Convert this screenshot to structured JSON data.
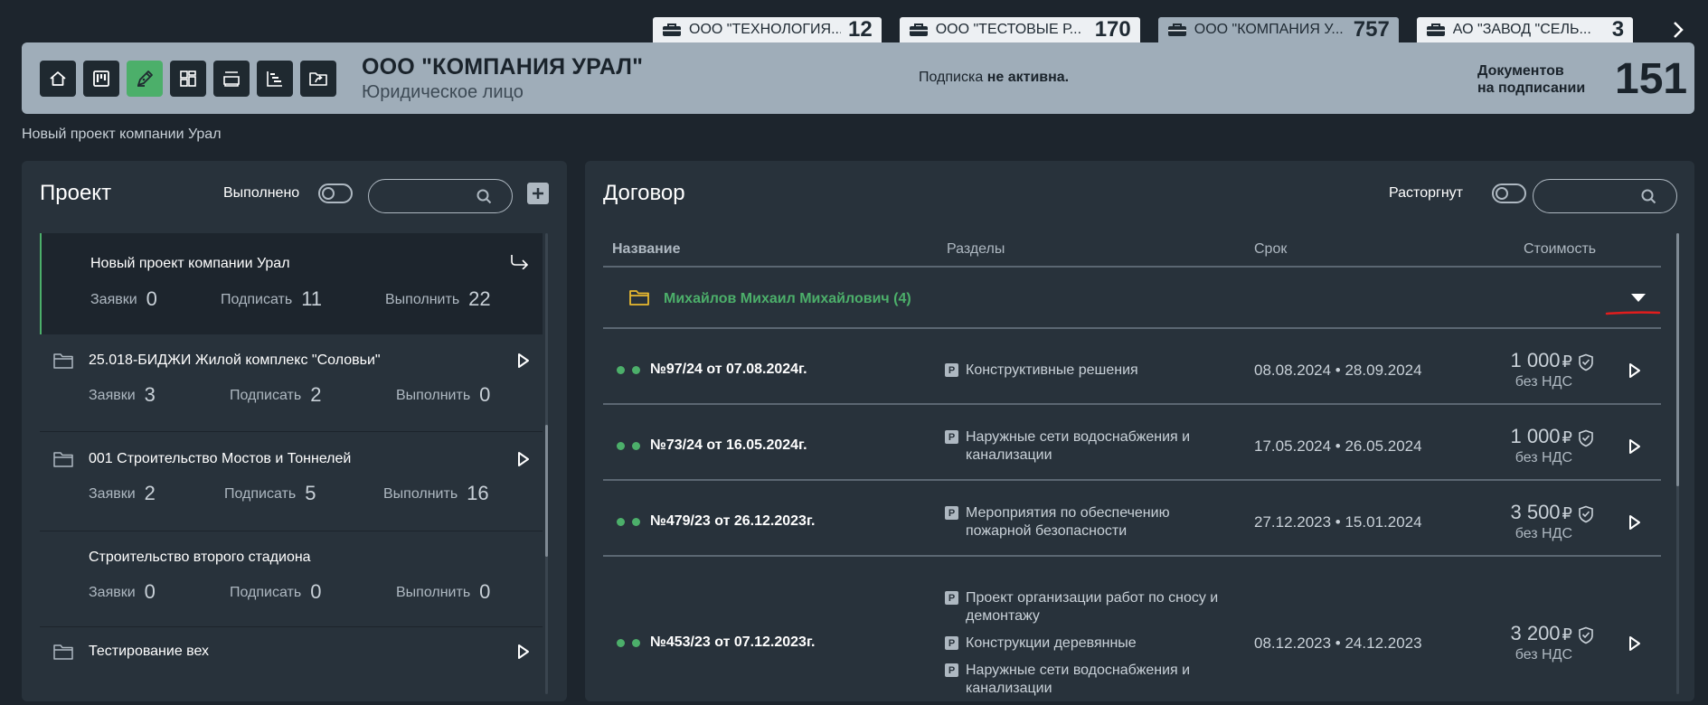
{
  "company_tabs": [
    {
      "name": "ООО \"ТЕХНОЛОГИЯ...",
      "count": "12",
      "active": false
    },
    {
      "name": "ООО \"ТЕСТОВЫЕ Р...",
      "count": "170",
      "active": false
    },
    {
      "name": "ООО \"КОМПАНИЯ У...",
      "count": "757",
      "active": true
    },
    {
      "name": "АО \"ЗАВОД \"СЕЛЬ...",
      "count": "3",
      "active": false
    }
  ],
  "toolbar": {
    "buttons": [
      "home-icon",
      "kanban-icon",
      "pen-icon",
      "dashboard-icon",
      "layers-icon",
      "gantt-icon",
      "folder-share-icon"
    ],
    "active_index": 2
  },
  "header": {
    "company_name": "ООО \"КОМПАНИЯ УРАЛ\"",
    "company_type": "Юридическое лицо",
    "subscription_prefix": "Подписка",
    "subscription_status": "не активна.",
    "docs_label_line1": "Документов",
    "docs_label_line2": "на подписании",
    "docs_count": "151"
  },
  "breadcrumb": "Новый проект компании Урал",
  "projects_panel": {
    "title": "Проект",
    "toggle_label": "Выполнено",
    "search_placeholder": "",
    "items": [
      {
        "name": "Новый проект компании Урал",
        "has_folder": false,
        "selected": true,
        "action": "redirect",
        "stats": [
          {
            "label": "Заявки",
            "value": "0"
          },
          {
            "label": "Подписать",
            "value": "11"
          },
          {
            "label": "Выполнить",
            "value": "22"
          }
        ]
      },
      {
        "name": "25.018-БИДЖИ Жилой комплекс \"Соловьи\"",
        "has_folder": true,
        "selected": false,
        "action": "play",
        "stats": [
          {
            "label": "Заявки",
            "value": "3"
          },
          {
            "label": "Подписать",
            "value": "2"
          },
          {
            "label": "Выполнить",
            "value": "0"
          }
        ]
      },
      {
        "name": "001 Строительство Мостов и Тоннелей",
        "has_folder": true,
        "selected": false,
        "action": "play",
        "stats": [
          {
            "label": "Заявки",
            "value": "2"
          },
          {
            "label": "Подписать",
            "value": "5"
          },
          {
            "label": "Выполнить",
            "value": "16"
          }
        ]
      },
      {
        "name": "Строительство второго стадиона",
        "has_folder": false,
        "selected": false,
        "action": "none",
        "stats": [
          {
            "label": "Заявки",
            "value": "0"
          },
          {
            "label": "Подписать",
            "value": "0"
          },
          {
            "label": "Выполнить",
            "value": "0"
          }
        ]
      },
      {
        "name": "Тестирование вех",
        "has_folder": true,
        "selected": false,
        "action": "play",
        "stats": []
      }
    ]
  },
  "contracts_panel": {
    "title": "Договор",
    "toggle_label": "Расторгнут",
    "search_placeholder": "",
    "columns": [
      "Название",
      "Разделы",
      "Срок",
      "Стоимость"
    ],
    "group": {
      "name": "Михайлов Михаил Михайлович (4)"
    },
    "rows": [
      {
        "number": "№97/24 от 07.08.2024г.",
        "sections": [
          "Конструктивные решения"
        ],
        "term": "08.08.2024 • 28.09.2024",
        "amount": "1 000",
        "currency": "₽",
        "vat": "без НДС"
      },
      {
        "number": "№73/24 от 16.05.2024г.",
        "sections": [
          "Наружные сети водоснабжения и канализации"
        ],
        "term": "17.05.2024 • 26.05.2024",
        "amount": "1 000",
        "currency": "₽",
        "vat": "без НДС"
      },
      {
        "number": "№479/23 от 26.12.2023г.",
        "sections": [
          "Мероприятия по обеспечению пожарной безопасности"
        ],
        "term": "27.12.2023 • 15.01.2024",
        "amount": "3 500",
        "currency": "₽",
        "vat": "без НДС"
      },
      {
        "number": "№453/23 от 07.12.2023г.",
        "sections": [
          "Проект организации работ по сносу и демонтажу",
          "Конструкции деревянные",
          "Наружные сети водоснабжения и канализации"
        ],
        "term": "08.12.2023 • 24.12.2023",
        "amount": "3 200",
        "currency": "₽",
        "vat": "без НДС"
      }
    ],
    "section_badge": "P"
  },
  "colors": {
    "accent_green": "#4caf6a",
    "header_bg": "#9fadb9",
    "panel_bg": "#28323b",
    "page_bg": "#1d252d",
    "annotation_red": "#e11d1d"
  }
}
